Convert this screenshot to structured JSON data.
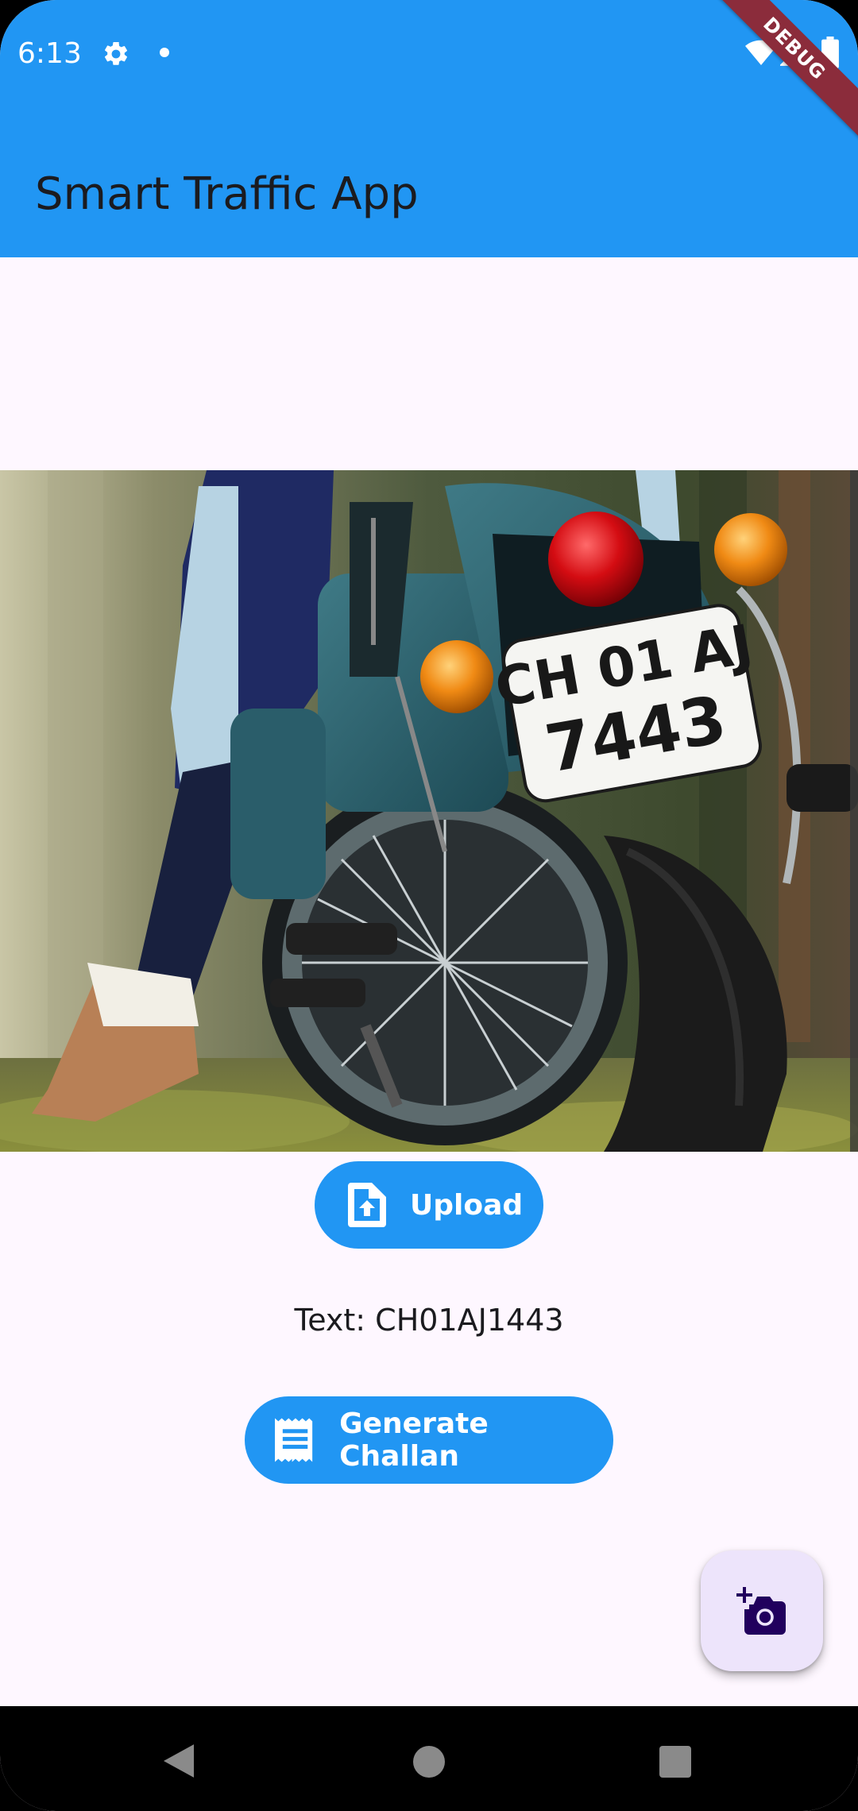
{
  "status_bar": {
    "time": "6:13",
    "icons": [
      "gear-icon",
      "notification-dot",
      "wifi-icon",
      "signal-icon",
      "battery-icon"
    ]
  },
  "debug_banner": "DEBUG",
  "app_bar": {
    "title": "Smart Traffic App",
    "color": "#2196f3"
  },
  "photo": {
    "plate_line_1": "CH 01 AJ",
    "plate_line_2": "7443"
  },
  "upload_button": {
    "label": "Upload",
    "icon": "upload-file-icon"
  },
  "result": {
    "text": "Text: CH01AJ1443"
  },
  "challan_button": {
    "label": "Generate Challan",
    "icon": "receipt-icon"
  },
  "fab": {
    "icon": "add-a-photo-icon",
    "color": "#ede4fb"
  },
  "nav_bar": {
    "icons": [
      "back-icon",
      "home-icon",
      "recents-icon"
    ]
  }
}
